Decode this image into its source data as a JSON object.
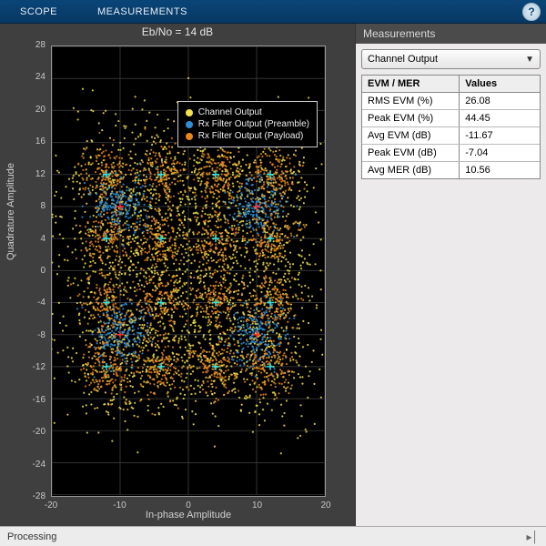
{
  "toolbar": {
    "tab_scope": "SCOPE",
    "tab_measurements": "MEASUREMENTS"
  },
  "plot": {
    "title": "Eb/No = 14 dB",
    "xlabel": "In-phase Amplitude",
    "ylabel": "Quadrature Amplitude",
    "xlim": [
      -20,
      20
    ],
    "ylim": [
      -28,
      28
    ],
    "xticks": [
      -20,
      -10,
      0,
      10,
      20
    ],
    "yticks": [
      -28,
      -24,
      -20,
      -16,
      -12,
      -8,
      -4,
      0,
      4,
      8,
      12,
      16,
      20,
      24,
      28
    ]
  },
  "legend": {
    "items": [
      {
        "label": "Channel Output",
        "color": "#f5e24b"
      },
      {
        "label": "Rx Filter Output (Preamble)",
        "color": "#2f8fd6"
      },
      {
        "label": "Rx Filter Output (Payload)",
        "color": "#e8861c"
      }
    ]
  },
  "chart_data": {
    "type": "scatter",
    "series": [
      {
        "name": "Channel Output",
        "color": "#f5e24b",
        "centers": [
          [
            -12,
            -12
          ],
          [
            -4,
            -12
          ],
          [
            4,
            -12
          ],
          [
            12,
            -12
          ],
          [
            -12,
            -4
          ],
          [
            -4,
            -4
          ],
          [
            4,
            -4
          ],
          [
            12,
            -4
          ],
          [
            -12,
            4
          ],
          [
            -4,
            4
          ],
          [
            4,
            4
          ],
          [
            12,
            4
          ],
          [
            -12,
            12
          ],
          [
            -4,
            12
          ],
          [
            4,
            12
          ],
          [
            12,
            12
          ]
        ],
        "spread": 4.0,
        "points_per_center": 160
      },
      {
        "name": "Rx Filter Output (Preamble)",
        "color": "#2f8fd6",
        "centers": [
          [
            -10,
            8
          ],
          [
            10,
            8
          ],
          [
            -10,
            -8
          ],
          [
            10,
            -8
          ]
        ],
        "spread": 2.0,
        "points_per_center": 220
      },
      {
        "name": "Rx Filter Output (Payload)",
        "color": "#e8861c",
        "centers": [
          [
            -12,
            -12
          ],
          [
            -4,
            -12
          ],
          [
            4,
            -12
          ],
          [
            12,
            -12
          ],
          [
            -12,
            -4
          ],
          [
            -4,
            -4
          ],
          [
            4,
            -4
          ],
          [
            12,
            -4
          ],
          [
            -12,
            4
          ],
          [
            -4,
            4
          ],
          [
            4,
            4
          ],
          [
            12,
            4
          ],
          [
            -12,
            12
          ],
          [
            -4,
            12
          ],
          [
            4,
            12
          ],
          [
            12,
            12
          ]
        ],
        "spread": 1.8,
        "points_per_center": 140
      }
    ],
    "markers_cyan": [
      [
        -12,
        -12
      ],
      [
        -4,
        -12
      ],
      [
        4,
        -12
      ],
      [
        12,
        -12
      ],
      [
        -12,
        -4
      ],
      [
        -4,
        -4
      ],
      [
        4,
        -4
      ],
      [
        12,
        -4
      ],
      [
        -12,
        4
      ],
      [
        -4,
        4
      ],
      [
        4,
        4
      ],
      [
        12,
        4
      ],
      [
        -12,
        12
      ],
      [
        -4,
        12
      ],
      [
        4,
        12
      ],
      [
        12,
        12
      ]
    ],
    "markers_red": [
      [
        -10,
        8
      ],
      [
        10,
        8
      ],
      [
        -10,
        -8
      ],
      [
        10,
        -8
      ]
    ]
  },
  "panel": {
    "title": "Measurements",
    "dropdown_value": "Channel Output",
    "headers": {
      "name": "EVM / MER",
      "value": "Values"
    },
    "rows": [
      {
        "name": "RMS EVM (%)",
        "value": "26.08"
      },
      {
        "name": "Peak EVM (%)",
        "value": "44.45"
      },
      {
        "name": "Avg EVM (dB)",
        "value": "-11.67"
      },
      {
        "name": "Peak EVM (dB)",
        "value": "-7.04"
      },
      {
        "name": "Avg MER (dB)",
        "value": "10.56"
      }
    ]
  },
  "status": {
    "text": "Processing",
    "icon": "▸│"
  }
}
